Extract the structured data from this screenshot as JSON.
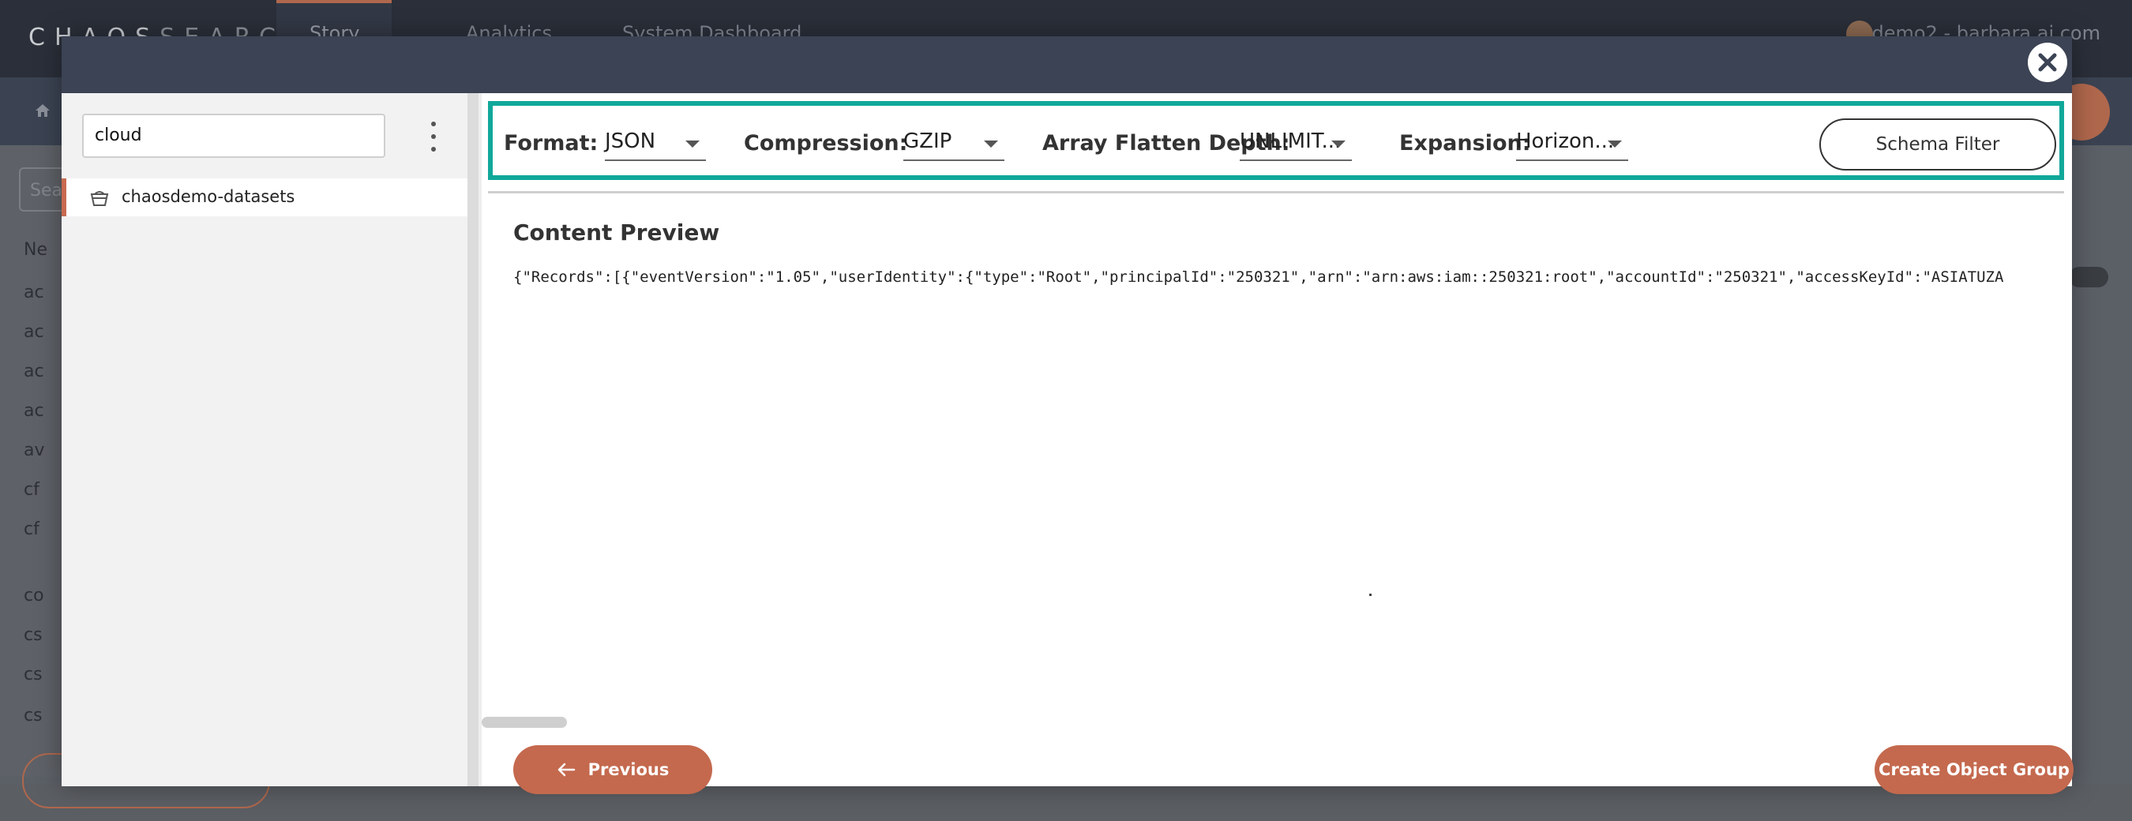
{
  "background": {
    "brand_bright": "CHAOS",
    "brand_dim": "SEARCH",
    "nav_tabs": [
      "Story",
      "Analytics",
      "System Dashboard"
    ],
    "user_label": "demo2 - barbara.ai.com",
    "search_placeholder": "Sea",
    "list_items": [
      "Ne",
      "ac",
      "ac",
      "ac",
      "ac",
      "av",
      "cf",
      "cf",
      "co",
      "cs",
      "cs",
      "cs"
    ]
  },
  "modal": {
    "close_icon": "close-icon",
    "sidebar": {
      "search_value": "cloud",
      "datasets": [
        {
          "label": "chaosdemo-datasets",
          "icon": "bucket-icon",
          "selected": true
        }
      ]
    },
    "toolbar": {
      "format": {
        "label": "Format:",
        "value": "JSON"
      },
      "compression": {
        "label": "Compression:",
        "value": "GZIP"
      },
      "array_flatten_depth": {
        "label": "Array Flatten Depth:",
        "value": "UNLIMIT..."
      },
      "expansion": {
        "label": "Expansion:",
        "value": "Horizon..."
      },
      "schema_filter_label": "Schema Filter"
    },
    "preview": {
      "title": "Content Preview",
      "content": "{\"Records\":[{\"eventVersion\":\"1.05\",\"userIdentity\":{\"type\":\"Root\",\"principalId\":\"250321\",\"arn\":\"arn:aws:iam::250321:root\",\"accountId\":\"250321\",\"accessKeyId\":\"ASIATUZA"
    },
    "footer": {
      "previous_label": "Previous",
      "create_label": "Create Object Group"
    }
  },
  "colors": {
    "accent": "#c4694e",
    "highlight": "#10a89a",
    "header": "#3b4354"
  }
}
